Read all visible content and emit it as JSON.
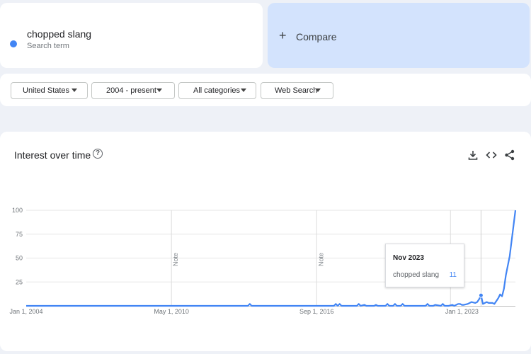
{
  "term": {
    "name": "chopped slang",
    "subtitle": "Search term",
    "color": "#4285f4"
  },
  "compare": {
    "label": "Compare"
  },
  "filters": [
    "United States",
    "2004 - present",
    "All categories",
    "Web Search"
  ],
  "chart_card": {
    "title": "Interest over time",
    "help_icon": "help-circle-icon",
    "tools": [
      "download-icon",
      "embed-code-icon",
      "share-icon"
    ]
  },
  "tooltip": {
    "date": "Nov 2023",
    "term": "chopped slang",
    "value": "11"
  },
  "chart_data": {
    "type": "line",
    "title": "Interest over time",
    "xlabel": "",
    "ylabel": "",
    "ylim": [
      0,
      100
    ],
    "y_ticks": [
      "100",
      "75",
      "50",
      "25"
    ],
    "x_ticks": [
      "Jan 1, 2004",
      "May 1, 2010",
      "Sep 1, 2016",
      "Jan 1, 2023"
    ],
    "annotations": [
      "Note",
      "Note",
      "Note"
    ],
    "grid": true,
    "series": [
      {
        "name": "chopped slang",
        "color": "#4285f4",
        "x": [
          "2004-01",
          "2007-01",
          "2010-01",
          "2013-01",
          "2013-09",
          "2013-10",
          "2013-11",
          "2014-01",
          "2016-01",
          "2017-06",
          "2017-07",
          "2017-08",
          "2017-09",
          "2017-10",
          "2017-11",
          "2018-06",
          "2018-07",
          "2018-08",
          "2018-10",
          "2018-11",
          "2019-03",
          "2019-04",
          "2019-05",
          "2019-09",
          "2019-10",
          "2019-11",
          "2020-01",
          "2020-02",
          "2020-03",
          "2020-05",
          "2020-06",
          "2020-07",
          "2021-01",
          "2021-06",
          "2021-07",
          "2021-08",
          "2021-10",
          "2021-11",
          "2022-02",
          "2022-03",
          "2022-04",
          "2022-05",
          "2022-06",
          "2022-08",
          "2022-09",
          "2022-11",
          "2022-12",
          "2023-01",
          "2023-02",
          "2023-04",
          "2023-06",
          "2023-08",
          "2023-09",
          "2023-10",
          "2023-11",
          "2023-12",
          "2024-01",
          "2024-02",
          "2024-03",
          "2024-04",
          "2024-05",
          "2024-06",
          "2024-07",
          "2024-08",
          "2024-09",
          "2024-10",
          "2024-11",
          "2024-12",
          "2025-01",
          "2025-02",
          "2025-03",
          "2025-04",
          "2025-05"
        ],
        "values": [
          0,
          0,
          0,
          0,
          0,
          2,
          0,
          0,
          0,
          0,
          2,
          0,
          2,
          0,
          0,
          0,
          2,
          0,
          1,
          0,
          0,
          1,
          0,
          0,
          2,
          0,
          0,
          2,
          0,
          0,
          2,
          0,
          0,
          0,
          2,
          0,
          0,
          1,
          0,
          2,
          0,
          0,
          0,
          1,
          0,
          2,
          2,
          1,
          1,
          2,
          4,
          3,
          4,
          7,
          11,
          2,
          3,
          4,
          3,
          3,
          3,
          2,
          5,
          8,
          12,
          10,
          18,
          32,
          42,
          52,
          68,
          84,
          100
        ]
      }
    ]
  }
}
